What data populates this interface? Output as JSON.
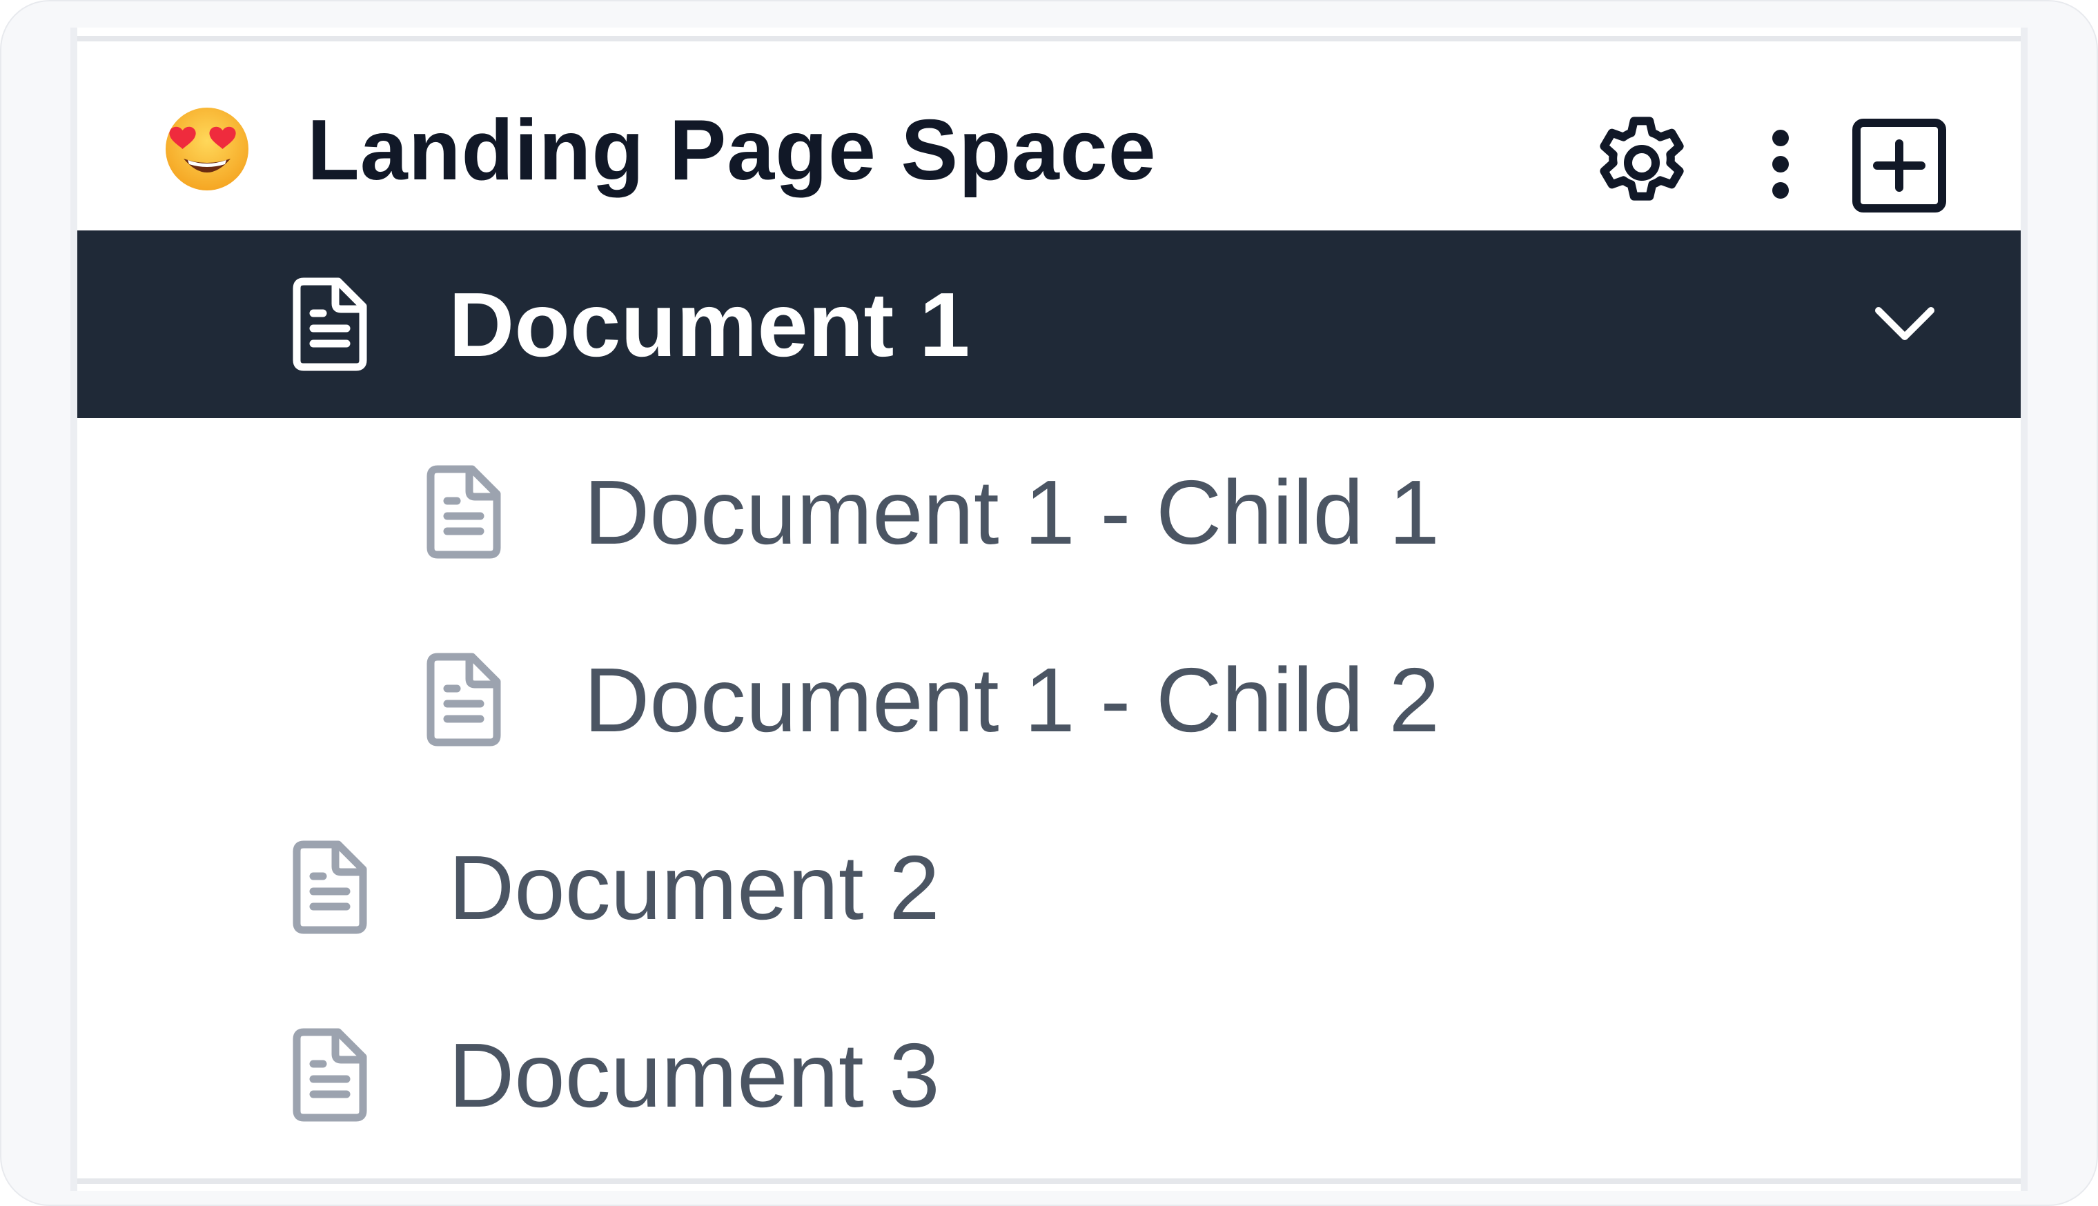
{
  "space": {
    "emoji": "😍",
    "title": "Landing Page Space"
  },
  "header_actions": {
    "settings_icon": "gear-icon",
    "more_icon": "more-vertical-icon",
    "add_icon": "plus-square-icon"
  },
  "tree": [
    {
      "label": "Document 1",
      "level": 0,
      "active": true,
      "expanded": true,
      "icon": "document-icon"
    },
    {
      "label": "Document 1 - Child 1",
      "level": 1,
      "active": false,
      "icon": "document-icon"
    },
    {
      "label": "Document 1 - Child 2",
      "level": 1,
      "active": false,
      "icon": "document-icon"
    },
    {
      "label": "Document 2",
      "level": 0,
      "active": false,
      "icon": "document-icon"
    },
    {
      "label": "Document 3",
      "level": 0,
      "active": false,
      "icon": "document-icon"
    }
  ],
  "colors": {
    "active_row_bg": "#1f2937",
    "active_text": "#ffffff",
    "item_text": "#4b5563",
    "title_text": "#111827",
    "icon_gray": "#9ca3af"
  }
}
